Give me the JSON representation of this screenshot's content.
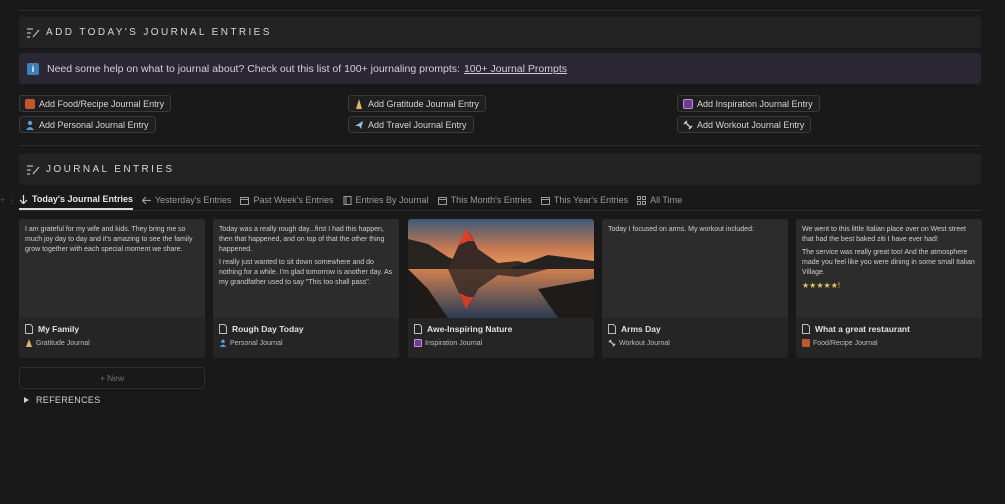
{
  "add_section": {
    "title": "ADD TODAY'S JOURNAL ENTRIES",
    "icon": "list-pen-icon"
  },
  "callout": {
    "icon": "info-icon",
    "icon_glyph": "i",
    "text": "Need some help on what to journal about?  Check out this list of 100+ journaling prompts:",
    "link_text": "100+ Journal Prompts"
  },
  "buttons": [
    {
      "label": "Add Food/Recipe Journal Entry",
      "icon": "food-icon"
    },
    {
      "label": "Add Personal Journal Entry",
      "icon": "person-icon"
    },
    {
      "label": "Add Gratitude Journal Entry",
      "icon": "pray-icon"
    },
    {
      "label": "Add Travel Journal Entry",
      "icon": "airplane-icon"
    },
    {
      "label": "Add Inspiration Journal Entry",
      "icon": "sparkle-icon"
    },
    {
      "label": "Add Workout Journal Entry",
      "icon": "dumbbell-icon"
    }
  ],
  "entries_section": {
    "title": "JOURNAL ENTRIES",
    "icon": "list-pen-icon"
  },
  "tabs": [
    {
      "label": "Today's Journal Entries",
      "icon": "arrow-down-icon",
      "active": true
    },
    {
      "label": "Yesterday's Entries",
      "icon": "arrow-left-icon",
      "active": false
    },
    {
      "label": "Past Week's Entries",
      "icon": "calendar-icon",
      "active": false
    },
    {
      "label": "Entries By Journal",
      "icon": "book-icon",
      "active": false
    },
    {
      "label": "This Month's Entries",
      "icon": "calendar-icon",
      "active": false
    },
    {
      "label": "This Year's Entries",
      "icon": "calendar-icon",
      "active": false
    },
    {
      "label": "All Time",
      "icon": "grid-icon",
      "active": false
    }
  ],
  "cards": [
    {
      "title": "My Family",
      "tag": "Gratitude Journal",
      "tag_icon": "pray-icon",
      "preview": [
        "I am grateful for my wife and kids.  They bring me so much joy day to day and it's amazing to see the family grow together with each special moment we share."
      ]
    },
    {
      "title": "Rough Day Today",
      "tag": "Personal Journal",
      "tag_icon": "person-icon",
      "preview": [
        "Today was a really rough day...first I had this happen, then that happened, and on top of that the other thing happened.",
        "I really just wanted to sit down somewhere and do nothing for a while.  I'm glad tomorrow is another day.  As my grandfather used to say \"This too shall pass\"."
      ]
    },
    {
      "title": "Awe-Inspiring Nature",
      "tag": "Inspiration Journal",
      "tag_icon": "sparkle-icon",
      "image": "mountain-lake-image",
      "preview": []
    },
    {
      "title": "Arms Day",
      "tag": "Workout Journal",
      "tag_icon": "dumbbell-icon",
      "preview": [
        "Today I focused on arms.  My workout included:"
      ]
    },
    {
      "title": "What a great restaurant",
      "tag": "Food/Recipe Journal",
      "tag_icon": "food-icon",
      "preview": [
        "We went to this little Italian place over on West street that had the best baked ziti I have ever had!",
        "The service was really great too!  And the atmosphere made you feel like you were dining in some small Italian Village.",
        "★★★★★!"
      ]
    }
  ],
  "new_button": {
    "label": "+ New"
  },
  "references": {
    "label": "REFERENCES"
  },
  "colors": {
    "background": "#191919",
    "callout_bg": "#2a2633",
    "card_bg": "#252525",
    "info_blue": "#3d7fb8",
    "peak_red": "#e0402a"
  }
}
